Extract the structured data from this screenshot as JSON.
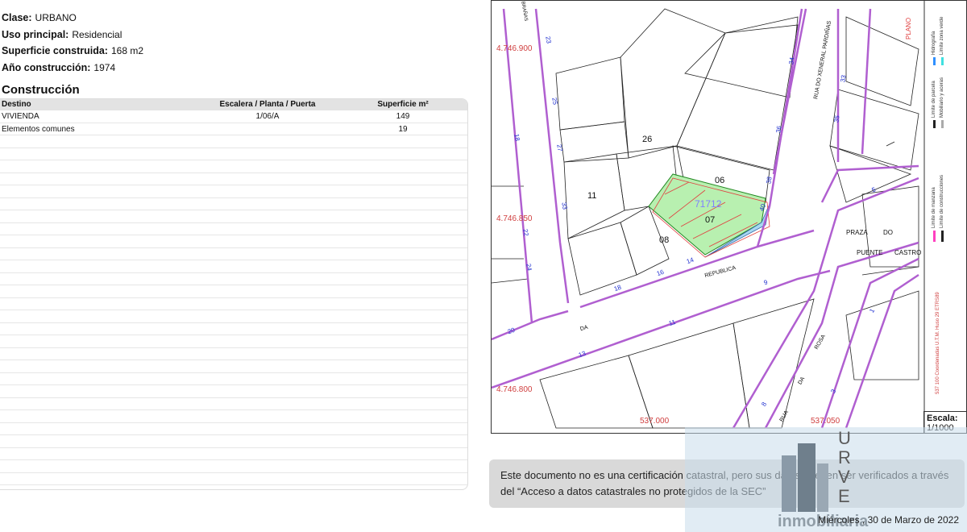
{
  "properties": [
    {
      "label": "Clase:",
      "value": "URBANO"
    },
    {
      "label": "Uso principal:",
      "value": "Residencial"
    },
    {
      "label": "Superficie construida:",
      "value": "168 m2"
    },
    {
      "label": "Año construcción:",
      "value": "1974"
    }
  ],
  "construccion": {
    "title": "Construcción",
    "headers": [
      "Destino",
      "Escalera / Planta / Puerta",
      "Superficie m²"
    ],
    "rows": [
      [
        "VIVIENDA",
        "1/06/A",
        "149"
      ],
      [
        "Elementos comunes",
        "",
        "19"
      ]
    ]
  },
  "map": {
    "coords": [
      "4.746.900",
      "4.746.850",
      "4.746.800",
      "537.000",
      "537.050"
    ],
    "parcels": [
      "26",
      "06",
      "11",
      "07",
      "08",
      "71712"
    ],
    "street_numbers": [
      "23",
      "25",
      "27",
      "33",
      "18",
      "22",
      "24",
      "20",
      "34",
      "36",
      "38",
      "40",
      "33",
      "35",
      "5",
      "1",
      "9",
      "11",
      "13",
      "14",
      "16",
      "18",
      "8",
      "3"
    ],
    "street_names": [
      "RUA DO XENERAL PARDIÑAS",
      "PRAZA",
      "DO",
      "PUENTE",
      "CASTRO",
      "REPUBLICA",
      "DA",
      "ROSA",
      "DA",
      "RUA",
      "BRAÑAS"
    ],
    "legend": [
      "Limite de manzana",
      "Limite de construcciones",
      "Limite de parcela",
      "Mobiliario y aceras",
      "Hidrografia",
      "Limite zona verde"
    ],
    "projection": "537 100 Coordenadas U.T.M. Huso 29 ETRS89",
    "scale_label": "Escala:",
    "scale_value": "1/1000"
  },
  "notice": "Este documento no es una certificación catastral, pero sus datos pueden ser verificados a través del “Acceso a datos catastrales no protegidos de la SEC”",
  "date": "Miércoles , 30 de Marzo de 2022",
  "watermark": {
    "letters": [
      "U",
      "R",
      "V",
      "E"
    ],
    "text": "inmobiliaria"
  }
}
